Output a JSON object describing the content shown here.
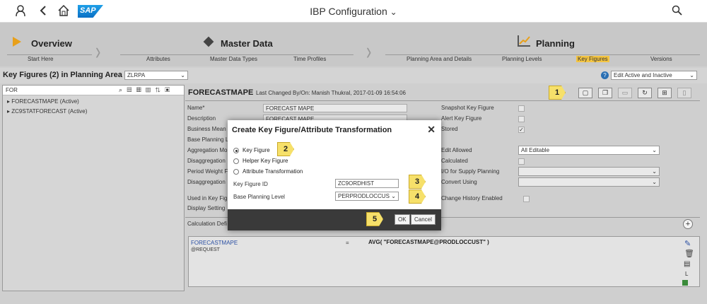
{
  "app": {
    "title": "IBP Configuration",
    "chevron": "⌄",
    "sap": "SAP"
  },
  "steps": {
    "overview": "Overview",
    "master": "Master Data",
    "planning": "Planning",
    "start": "Start Here",
    "attributes": "Attributes",
    "mdt": "Master Data Types",
    "tp": "Time Profiles",
    "pad": "Planning Area and Details",
    "pl": "Planning Levels",
    "kf": "Key Figures",
    "ver": "Versions"
  },
  "header": {
    "title": "Key Figures (2) in Planning Area",
    "area": "ZLRPA",
    "filter": "Edit Active and Inactive"
  },
  "left": {
    "search": "FOR",
    "items": [
      "FORECASTMAPE (Active)",
      "ZC9STATFORECAST (Active)"
    ]
  },
  "detail": {
    "name": "FORECASTMAPE",
    "changed": "Last Changed By/On: Manish Thukral, 2017-01-09 16:54:06",
    "labels": [
      "Name*",
      "Description",
      "Business Mean",
      "Base Planning L",
      "Aggregation Mo",
      "Disaggregation",
      "Period Weight F",
      "Disaggregation",
      "Used in Key Fig",
      "Display Setting"
    ],
    "name_val": "FORECAST MAPE",
    "desc_val": "FORECAST MAPE",
    "r_labels": [
      "Snapshot Key Figure",
      "Alert Key Figure",
      "Stored",
      "Edit Allowed",
      "Calculated",
      "I/O for Supply Planning",
      "Convert Using",
      "Change History Enabled"
    ],
    "edit_allowed": "All Editable",
    "calc_def": "Calculation Defi",
    "calc_name": "FORECASTMAPE",
    "calc_req": "@REQUEST",
    "calc_eq": "=",
    "calc_expr": "AVG( \"FORECASTMAPE@PRODLOCCUST\" )"
  },
  "modal": {
    "title": "Create Key Figure/Attribute Transformation",
    "r1": "Key Figure",
    "r2": "Helper Key Figure",
    "r3": "Attribute Transformation",
    "kf_id_label": "Key Figure ID",
    "kf_id": "ZC9ORDHIST",
    "bpl_label": "Base Planning Level",
    "bpl": "PERPRODLOCCUS",
    "ok": "OK",
    "cancel": "Cancel"
  },
  "callouts": [
    "1",
    "2",
    "3",
    "4",
    "5"
  ]
}
